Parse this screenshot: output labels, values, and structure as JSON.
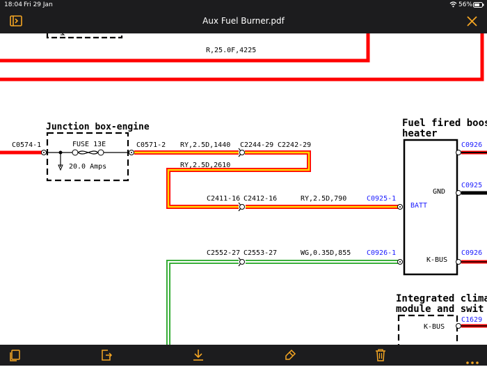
{
  "status": {
    "time": "18:04",
    "date": "Fri 29 Jan",
    "battery": "56%"
  },
  "viewer": {
    "title": "Aux Fuel Burner.pdf"
  },
  "diagram": {
    "top_wire_label": "R,25.0F,4225",
    "junction_box_title": "Junction box-engine",
    "fuse_label": "FUSE 13E",
    "fuse_rating": "20.0 Amps",
    "c0574": "C0574-1",
    "c0571": "C0571-2",
    "wire_ry_1440": "RY,2.5D,1440",
    "c2244": "C2244-29",
    "c2242": "C2242-29",
    "wire_ry_2610": "RY,2.5D,2610",
    "c2411": "C2411-16",
    "c2412": "C2412-16",
    "wire_ry_790": "RY,2.5D,790",
    "c0925_1": "C0925-1",
    "batt": "BATT",
    "gnd": "GND",
    "c2552": "C2552-27",
    "c2553": "C2553-27",
    "wire_wg_855": "WG,0.35D,855",
    "c0926_1": "C0926-1",
    "kbus": "K-BUS",
    "heater_title_1": "Fuel fired boost",
    "heater_title_2": "heater",
    "right_c0926_a": "C0926",
    "right_c0925": "C0925",
    "right_c0926_b": "C0926",
    "climate_title_1": "Integrated climat",
    "climate_title_2": "module and swit",
    "climate_kbus": "K-BUS",
    "right_c1629": "C1629"
  },
  "colors": {
    "bar": "#1c1c1e",
    "accent": "#f5a623",
    "wire_red": "#ff0000",
    "wire_yellow": "#ffd700",
    "wire_green": "#2eaa2e",
    "link_blue": "#1a1aff"
  }
}
